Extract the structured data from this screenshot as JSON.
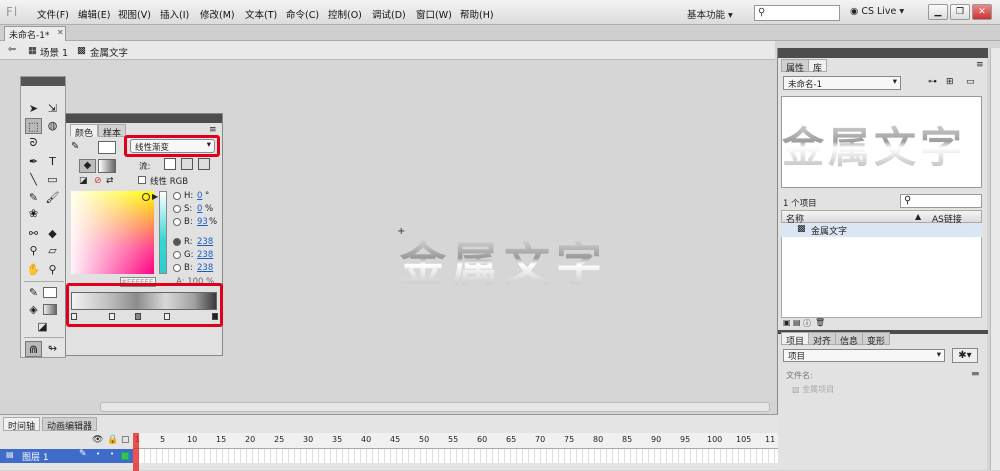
{
  "app": {
    "logo": "Fl"
  },
  "menu": [
    "文件(F)",
    "编辑(E)",
    "视图(V)",
    "插入(I)",
    "修改(M)",
    "文本(T)",
    "命令(C)",
    "控制(O)",
    "调试(D)",
    "窗口(W)",
    "帮助(H)"
  ],
  "workspace": "基本功能",
  "cslive": "CS Live",
  "doc_tab": "未命名-1*",
  "scene": {
    "label": "场景 1",
    "symbol": "金属文字"
  },
  "stage": {
    "text": "金属文字"
  },
  "color_panel": {
    "tabs": [
      "颜色",
      "样本"
    ],
    "type": "线性渐变",
    "flow_label": "流:",
    "linear_rgb": "线性 RGB",
    "hsb": [
      {
        "label": "H:",
        "value": "0",
        "unit": "°"
      },
      {
        "label": "S:",
        "value": "0",
        "unit": "%"
      },
      {
        "label": "B:",
        "value": "93",
        "unit": "%"
      }
    ],
    "rgb": [
      {
        "label": "R:",
        "value": "238"
      },
      {
        "label": "G:",
        "value": "238"
      },
      {
        "label": "B:",
        "value": "238"
      }
    ],
    "alpha": "A: 100 %",
    "hex": "#EEEEEE"
  },
  "right_panel": {
    "tabs": [
      "属性",
      "库"
    ],
    "library_select": "未命名-1",
    "preview_text": "金属文字",
    "item_count": "1 个项目",
    "col_name": "名称",
    "col_link": "AS链接",
    "items": [
      "金属文字"
    ],
    "lower_tabs": [
      "项目",
      "对齐",
      "信息",
      "变形"
    ],
    "project_select": "项目",
    "file_label": "文件名:",
    "file_item": "金属项目"
  },
  "timeline": {
    "tabs": [
      "时间轴",
      "动画编辑器"
    ],
    "layer": "图层 1",
    "ruler": [
      "1",
      "5",
      "10",
      "15",
      "20",
      "25",
      "30",
      "35",
      "40",
      "45",
      "50",
      "55",
      "60",
      "65",
      "70",
      "75",
      "80",
      "85",
      "90",
      "95",
      "100",
      "105",
      "11"
    ]
  }
}
